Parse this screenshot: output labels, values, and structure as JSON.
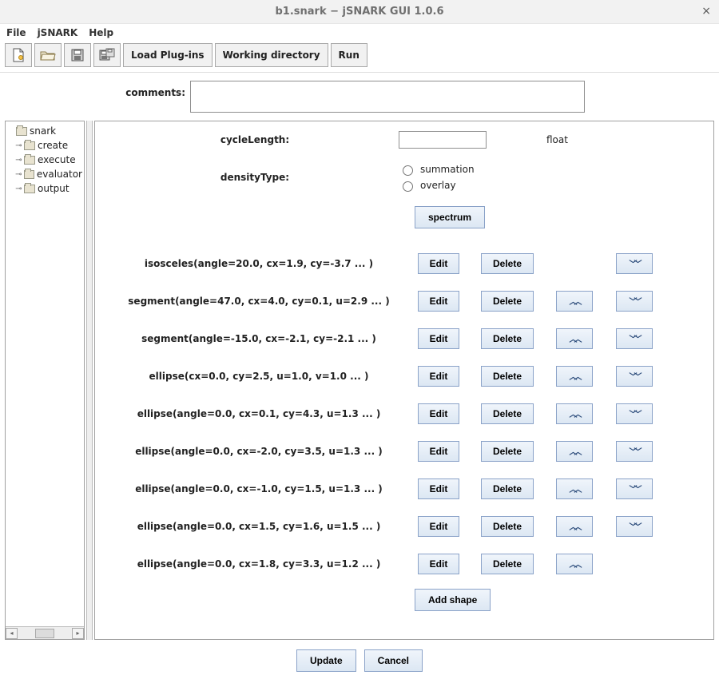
{
  "window": {
    "title": "b1.snark − jSNARK GUI 1.0.6"
  },
  "menu": {
    "file": "File",
    "jsnark": "jSNARK",
    "help": "Help"
  },
  "toolbar": {
    "load_plugins": "Load Plug-ins",
    "working_dir": "Working directory",
    "run": "Run"
  },
  "comments": {
    "label": "comments:",
    "value": ""
  },
  "tree": {
    "root": "snark",
    "children": [
      "create",
      "execute",
      "evaluator",
      "output"
    ]
  },
  "props": {
    "cycleLength": {
      "label": "cycleLength:",
      "value": "",
      "type": "float"
    },
    "densityType": {
      "label": "densityType:",
      "options": {
        "summation": "summation",
        "overlay": "overlay"
      }
    },
    "spectrum": "spectrum",
    "add_shape": "Add shape",
    "edit": "Edit",
    "delete": "Delete"
  },
  "shapes": [
    {
      "desc": "isosceles(angle=20.0, cx=1.9, cy=-3.7 ... )",
      "up": false,
      "down": true
    },
    {
      "desc": "segment(angle=47.0, cx=4.0, cy=0.1, u=2.9 ... )",
      "up": true,
      "down": true
    },
    {
      "desc": "segment(angle=-15.0, cx=-2.1, cy=-2.1 ... )",
      "up": true,
      "down": true
    },
    {
      "desc": "ellipse(cx=0.0, cy=2.5, u=1.0, v=1.0 ... )",
      "up": true,
      "down": true
    },
    {
      "desc": "ellipse(angle=0.0, cx=0.1, cy=4.3, u=1.3 ... )",
      "up": true,
      "down": true
    },
    {
      "desc": "ellipse(angle=0.0, cx=-2.0, cy=3.5, u=1.3 ... )",
      "up": true,
      "down": true
    },
    {
      "desc": "ellipse(angle=0.0, cx=-1.0, cy=1.5, u=1.3 ... )",
      "up": true,
      "down": true
    },
    {
      "desc": "ellipse(angle=0.0, cx=1.5, cy=1.6, u=1.5 ... )",
      "up": true,
      "down": true
    },
    {
      "desc": "ellipse(angle=0.0, cx=1.8, cy=3.3, u=1.2 ... )",
      "up": true,
      "down": false
    }
  ],
  "footer": {
    "update": "Update",
    "cancel": "Cancel"
  }
}
